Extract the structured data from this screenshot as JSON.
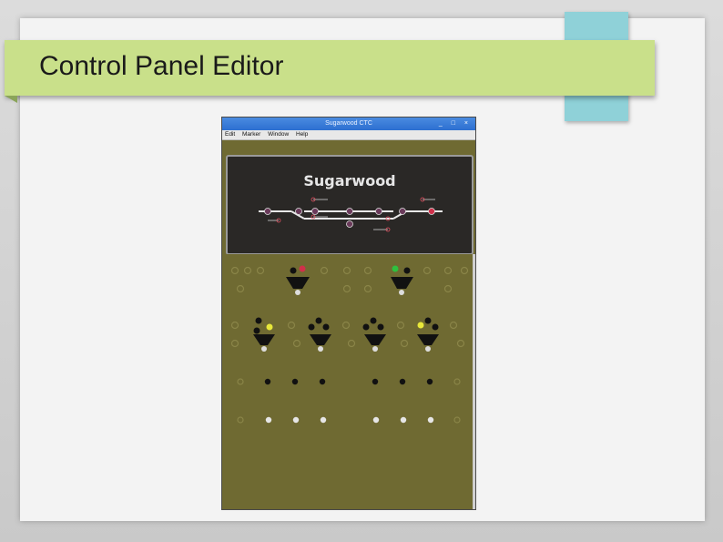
{
  "slide": {
    "title": "Control Panel Editor"
  },
  "window": {
    "title": "Sugarwood CTC",
    "controls": "_ □ ×",
    "menu": [
      "Edit",
      "Marker",
      "Window",
      "Help"
    ],
    "board_title": "Sugarwood"
  },
  "colors": {
    "title_band": "#c9e08a",
    "accent_tab": "#8fd1d8",
    "panel_bg": "#6f6a32",
    "board_bg": "#2a2826",
    "signal_red": "#d0304a",
    "signal_green": "#2fbf3f",
    "signal_yellow": "#e8e83a"
  }
}
